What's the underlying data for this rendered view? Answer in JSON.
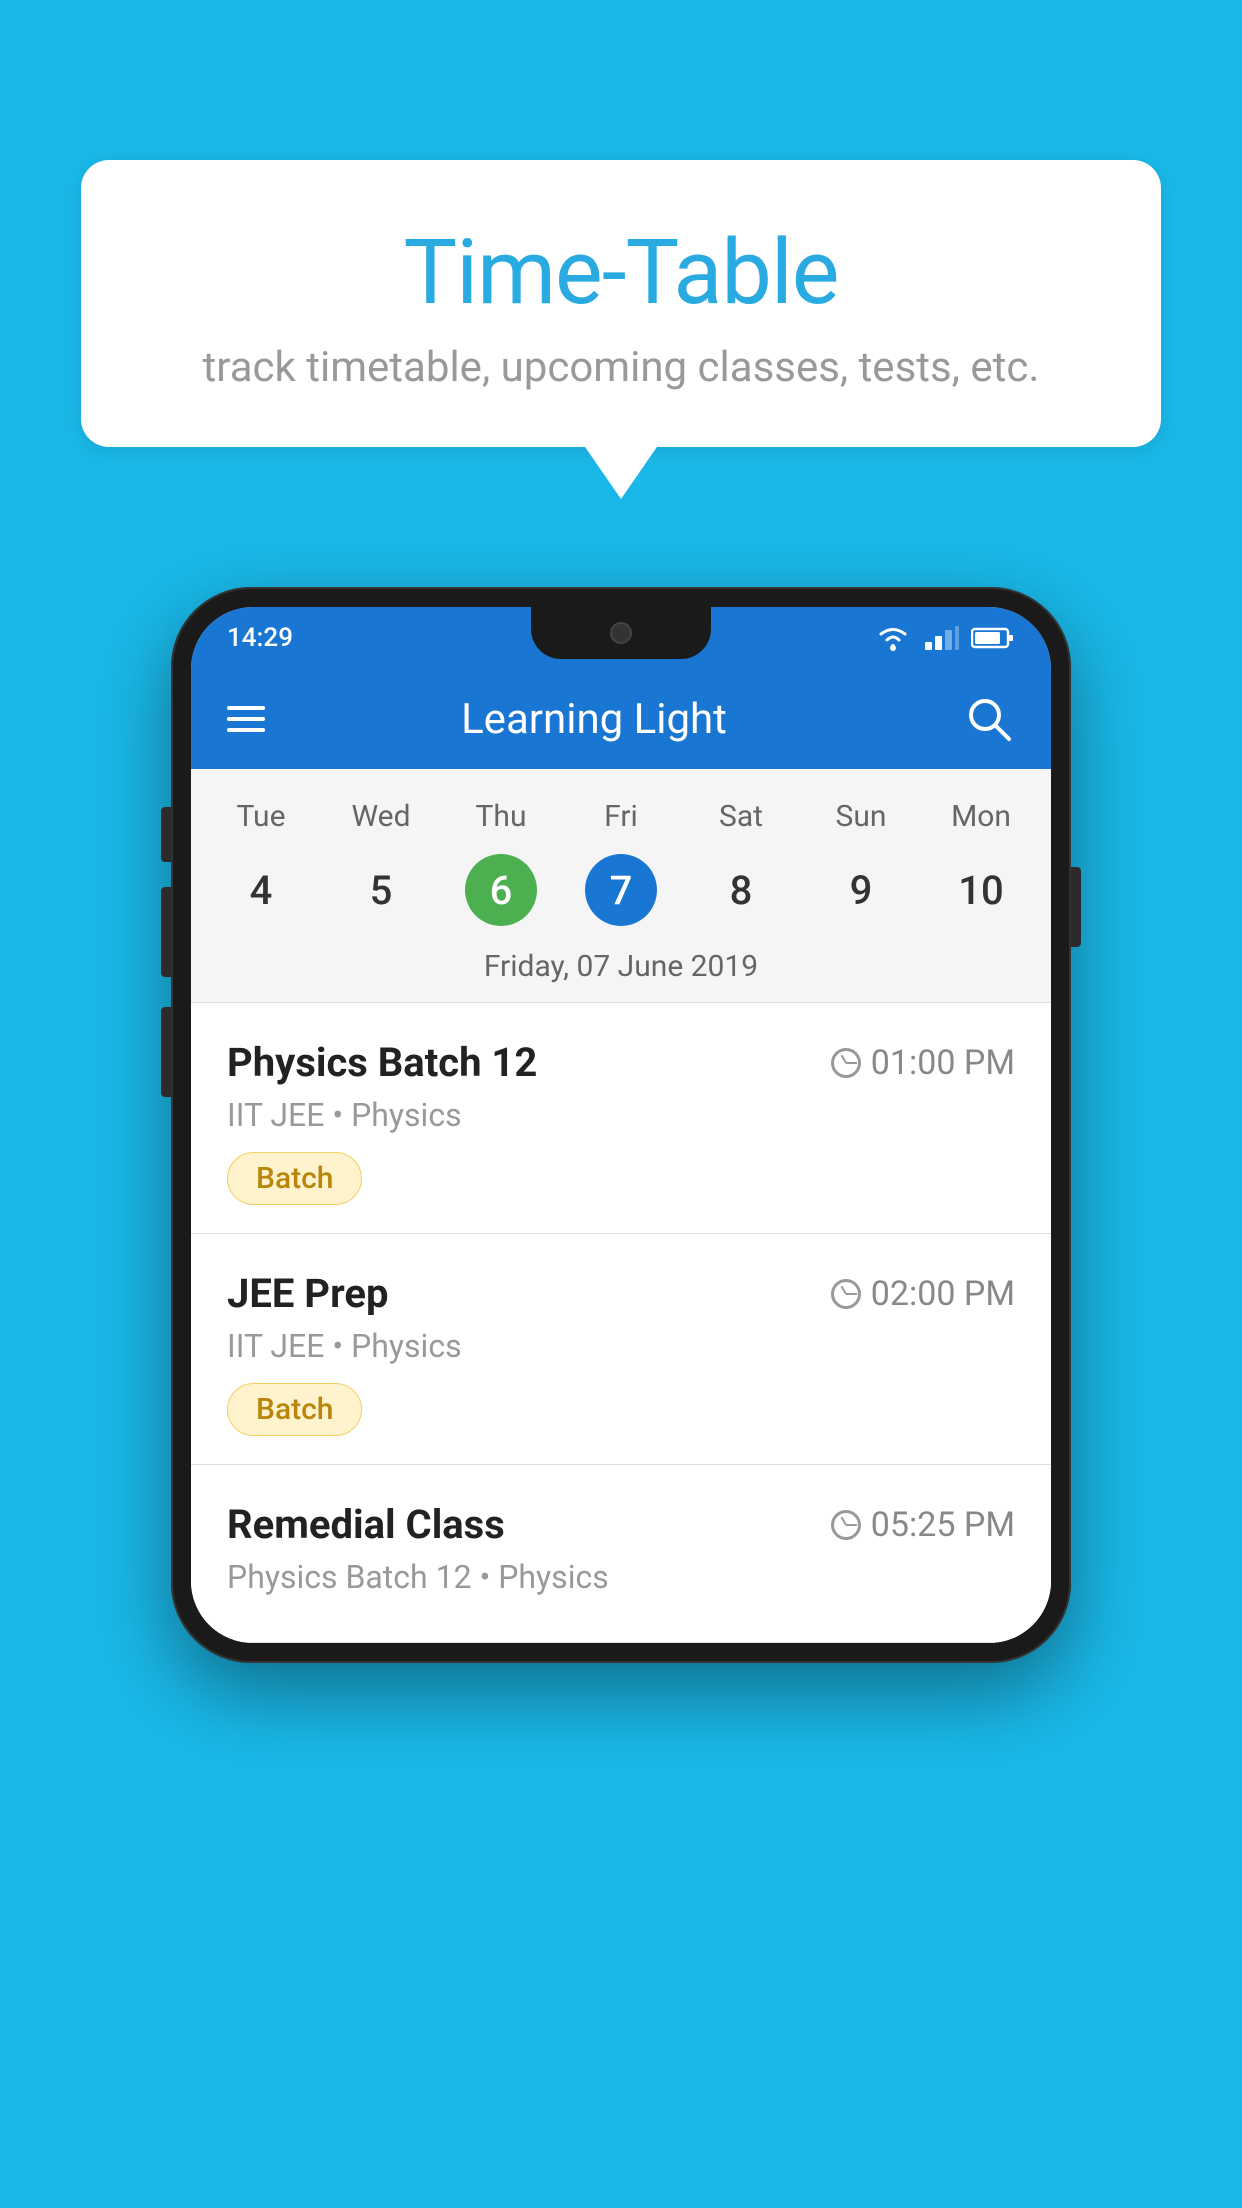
{
  "background_color": "#1ab8e8",
  "speech_bubble": {
    "title": "Time-Table",
    "subtitle": "track timetable, upcoming classes, tests, etc."
  },
  "phone": {
    "status_bar": {
      "time": "14:29"
    },
    "app_bar": {
      "title": "Learning Light"
    },
    "calendar": {
      "days": [
        "Tue",
        "Wed",
        "Thu",
        "Fri",
        "Sat",
        "Sun",
        "Mon"
      ],
      "dates": [
        "4",
        "5",
        "6",
        "7",
        "8",
        "9",
        "10"
      ],
      "today_index": 2,
      "selected_index": 3,
      "selected_date_label": "Friday, 07 June 2019"
    },
    "classes": [
      {
        "name": "Physics Batch 12",
        "time": "01:00 PM",
        "subtitle": "IIT JEE • Physics",
        "tag": "Batch"
      },
      {
        "name": "JEE Prep",
        "time": "02:00 PM",
        "subtitle": "IIT JEE • Physics",
        "tag": "Batch"
      },
      {
        "name": "Remedial Class",
        "time": "05:25 PM",
        "subtitle": "Physics Batch 12 • Physics",
        "tag": null
      }
    ]
  }
}
